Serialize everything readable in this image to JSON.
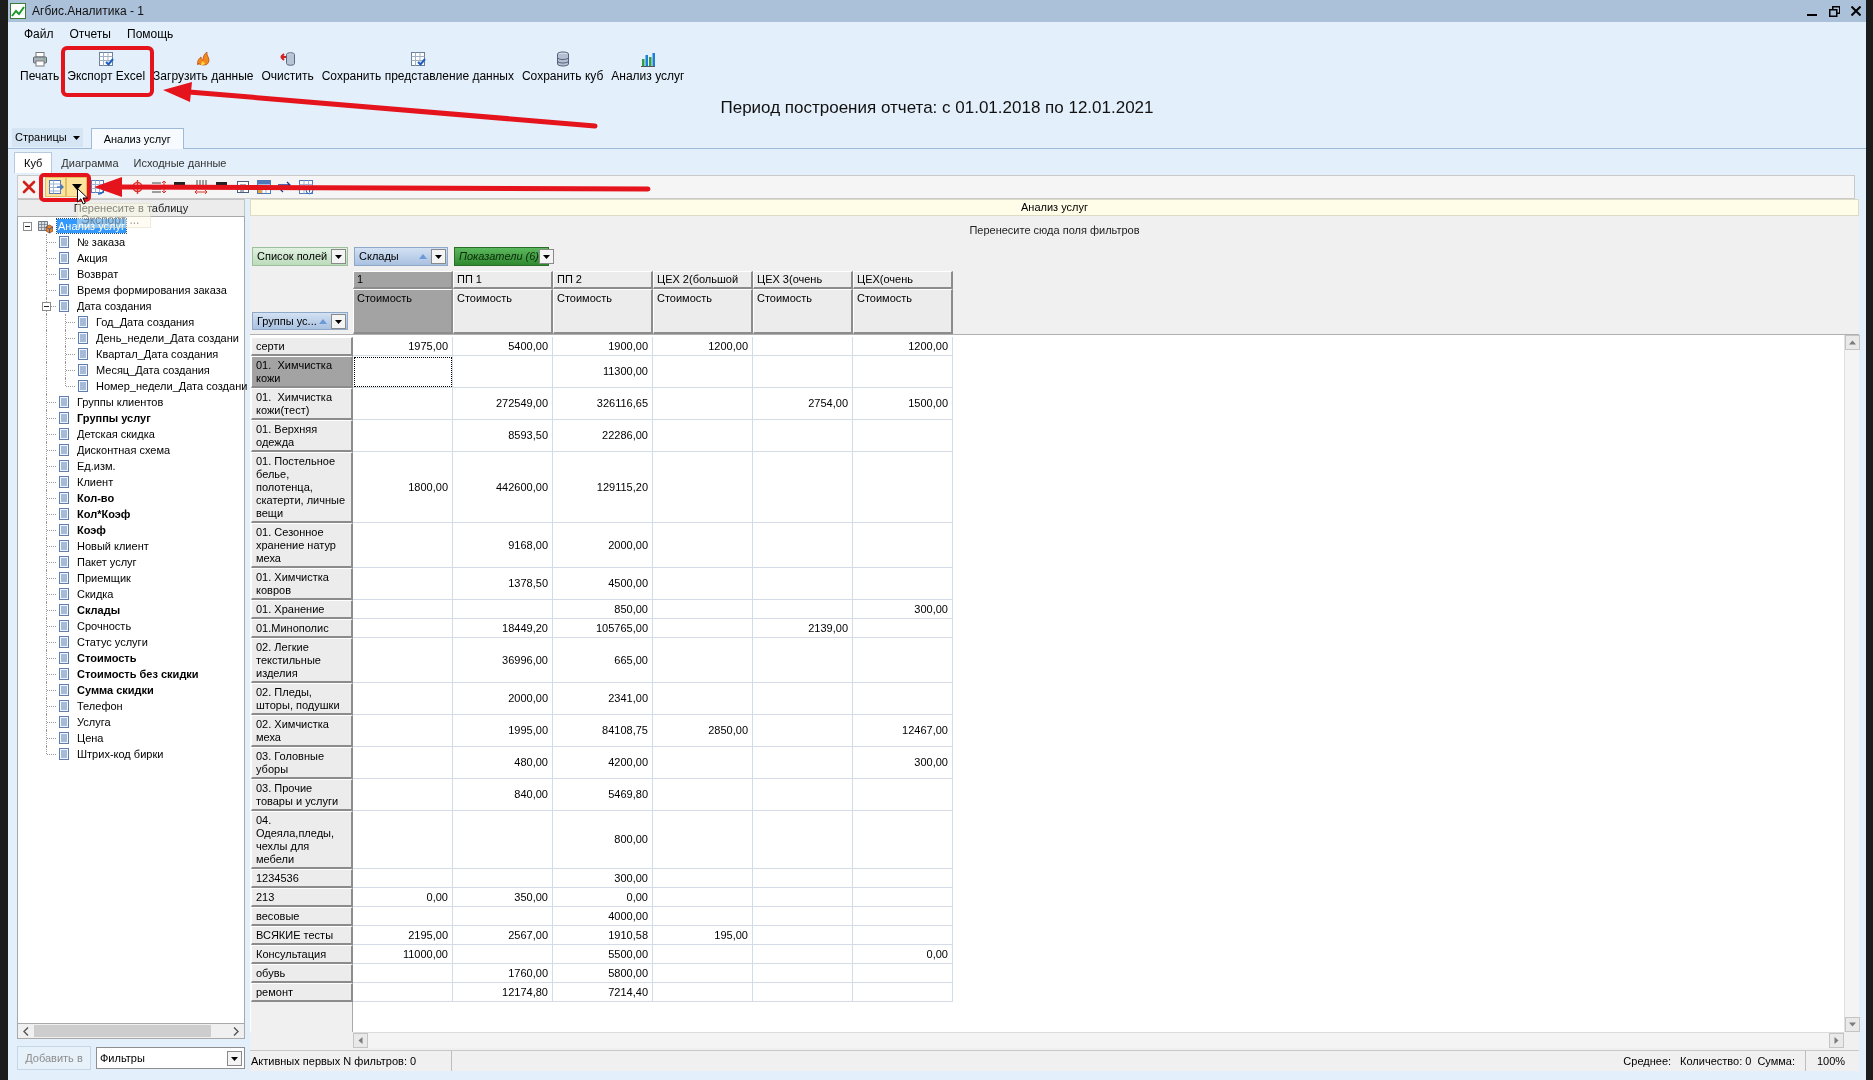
{
  "window": {
    "title": "Агбис.Аналитика - 1"
  },
  "menu": [
    {
      "label": "Файл"
    },
    {
      "label": "Отчеты"
    },
    {
      "label": "Помощь"
    }
  ],
  "toolbar": [
    {
      "kind": "print",
      "label": "Печать"
    },
    {
      "kind": "export",
      "label": "Экспорт Excel"
    },
    {
      "kind": "load",
      "label": "Загрузить данные"
    },
    {
      "kind": "clear",
      "label": "Очистить"
    },
    {
      "kind": "save_view",
      "label": "Сохранить представление данных"
    },
    {
      "kind": "save_cube",
      "label": "Сохранить куб"
    },
    {
      "kind": "analysis",
      "label": "Анализ услуг"
    }
  ],
  "report_period": "Период построения отчета: с 01.01.2018 по 12.01.2021",
  "page_tabs": {
    "menu_label": "Страницы",
    "tabs": [
      {
        "label": "Анализ услуг",
        "selected": true
      }
    ]
  },
  "view_tabs": [
    {
      "label": "Куб",
      "selected": true
    },
    {
      "label": "Диаграмма",
      "selected": false
    },
    {
      "label": "Исходные данные",
      "selected": false
    }
  ],
  "cube_toolbar": [
    {
      "kind": "delete",
      "hovered": false
    },
    {
      "kind": "export",
      "hovered": true
    },
    {
      "kind": "export_menu",
      "hovered": true
    },
    {
      "kind": "table_arrow",
      "hovered": false
    },
    {
      "kind": "split",
      "hovered": false
    },
    {
      "kind": "rows",
      "hovered": false
    },
    {
      "kind": "dash",
      "hovered": false
    },
    {
      "kind": "columns",
      "hovered": false
    },
    {
      "kind": "dash",
      "hovered": false
    },
    {
      "kind": "form",
      "hovered": false
    },
    {
      "kind": "grid",
      "hovered": false
    },
    {
      "kind": "swap",
      "hovered": false
    },
    {
      "kind": "grid_info",
      "hovered": false
    }
  ],
  "tooltip": {
    "text": "Экспорт ..."
  },
  "field_panel": {
    "title": "Перенесите в таблицу",
    "tree": [
      {
        "label": "Анализ услуг",
        "selected": true,
        "active": false,
        "expanded": true,
        "children": [
          {
            "label": "№ заказа",
            "selected": false,
            "active": false
          },
          {
            "label": "Акция",
            "selected": false,
            "active": false
          },
          {
            "label": "Возврат",
            "selected": false,
            "active": false
          },
          {
            "label": "Время формирования заказа",
            "selected": false,
            "active": false
          },
          {
            "label": "Дата создания",
            "selected": false,
            "active": false,
            "expanded": true,
            "children": [
              {
                "label": "Год_Дата создания",
                "selected": false,
                "active": false
              },
              {
                "label": "День_недели_Дата создани",
                "selected": false,
                "active": false
              },
              {
                "label": "Квартал_Дата создания",
                "selected": false,
                "active": false
              },
              {
                "label": "Месяц_Дата создания",
                "selected": false,
                "active": false
              },
              {
                "label": "Номер_недели_Дата создани",
                "selected": false,
                "active": false
              }
            ]
          },
          {
            "label": "Группы клиентов",
            "selected": false,
            "active": false
          },
          {
            "label": "Группы услуг",
            "selected": false,
            "active": true
          },
          {
            "label": "Детская скидка",
            "selected": false,
            "active": false
          },
          {
            "label": "Дисконтная схема",
            "selected": false,
            "active": false
          },
          {
            "label": "Ед.изм.",
            "selected": false,
            "active": false
          },
          {
            "label": "Клиент",
            "selected": false,
            "active": false
          },
          {
            "label": "Кол-во",
            "selected": false,
            "active": true
          },
          {
            "label": "Кол*Коэф",
            "selected": false,
            "active": true
          },
          {
            "label": "Коэф",
            "selected": false,
            "active": true
          },
          {
            "label": "Новый клиент",
            "selected": false,
            "active": false
          },
          {
            "label": "Пакет услуг",
            "selected": false,
            "active": false
          },
          {
            "label": "Приемщик",
            "selected": false,
            "active": false
          },
          {
            "label": "Скидка",
            "selected": false,
            "active": false
          },
          {
            "label": "Склады",
            "selected": false,
            "active": true
          },
          {
            "label": "Срочность",
            "selected": false,
            "active": false
          },
          {
            "label": "Статус услуги",
            "selected": false,
            "active": false
          },
          {
            "label": "Стоимость",
            "selected": false,
            "active": true
          },
          {
            "label": "Стоимость без скидки",
            "selected": false,
            "active": true
          },
          {
            "label": "Сумма скидки",
            "selected": false,
            "active": true
          },
          {
            "label": "Телефон",
            "selected": false,
            "active": false
          },
          {
            "label": "Услуга",
            "selected": false,
            "active": false
          },
          {
            "label": "Цена",
            "selected": false,
            "active": false
          },
          {
            "label": "Штрих-код бирки",
            "selected": false,
            "active": false
          }
        ]
      }
    ],
    "add_button": {
      "label": "Добавить в",
      "disabled": true
    },
    "target": {
      "value": "Фильтры"
    }
  },
  "pivot": {
    "title": "Анализ услуг",
    "filter_hint": "Перенесите сюда поля фильтров",
    "field_list_button": "Список полей",
    "column_fields": [
      {
        "label": "Склады",
        "sort_ascending": true
      }
    ],
    "data_fields_button": "Показатели (6)",
    "row_fields": [
      {
        "label": "Группы ус...",
        "sort_ascending": true
      }
    ],
    "columns": [
      {
        "label": "1",
        "measure": "Стоимость",
        "selected": true
      },
      {
        "label": "ПП 1",
        "measure": "Стоимость",
        "selected": false
      },
      {
        "label": "ПП 2",
        "measure": "Стоимость",
        "selected": false
      },
      {
        "label": "ЦЕХ 2(большой",
        "measure": "Стоимость",
        "selected": false
      },
      {
        "label": "ЦЕХ 3(очень",
        "measure": "Стоимость",
        "selected": false
      },
      {
        "label": "ЦЕХ(очень",
        "measure": "Стоимость",
        "selected": false
      }
    ],
    "rows": [
      {
        "label": "серти",
        "selected": false,
        "values": {
          "col_1": "1975,00",
          "col_2": "5400,00",
          "col_3": "1900,00",
          "col_4": "1200,00",
          "col_6": "1200,00"
        }
      },
      {
        "label": "01.  Химчистка кожи",
        "selected": true,
        "values": {
          "col_3": "11300,00"
        }
      },
      {
        "label": "01.  Химчистка кожи(тест)",
        "selected": false,
        "values": {
          "col_2": "272549,00",
          "col_3": "326116,65",
          "col_5": "2754,00",
          "col_6": "1500,00"
        }
      },
      {
        "label": "01. Верхняя одежда",
        "selected": false,
        "values": {
          "col_2": "8593,50",
          "col_3": "22286,00"
        }
      },
      {
        "label": "01. Постельное белье, полотенца, скатерти, личные вещи",
        "selected": false,
        "values": {
          "col_1": "1800,00",
          "col_2": "442600,00",
          "col_3": "129115,20"
        }
      },
      {
        "label": "01. Сезонное хранение натур меха",
        "selected": false,
        "values": {
          "col_2": "9168,00",
          "col_3": "2000,00"
        }
      },
      {
        "label": "01. Химчистка ковров",
        "selected": false,
        "values": {
          "col_2": "1378,50",
          "col_3": "4500,00"
        }
      },
      {
        "label": "01. Хранение",
        "selected": false,
        "values": {
          "col_3": "850,00",
          "col_6": "300,00"
        }
      },
      {
        "label": "01.Минополис",
        "selected": false,
        "values": {
          "col_2": "18449,20",
          "col_3": "105765,00",
          "col_5": "2139,00"
        }
      },
      {
        "label": "02. Легкие текстильные изделия",
        "selected": false,
        "values": {
          "col_2": "36996,00",
          "col_3": "665,00"
        }
      },
      {
        "label": "02. Пледы, шторы, подушки",
        "selected": false,
        "values": {
          "col_2": "2000,00",
          "col_3": "2341,00"
        }
      },
      {
        "label": "02. Химчистка меха",
        "selected": false,
        "values": {
          "col_2": "1995,00",
          "col_3": "84108,75",
          "col_4": "2850,00",
          "col_6": "12467,00"
        }
      },
      {
        "label": "03. Головные уборы",
        "selected": false,
        "values": {
          "col_2": "480,00",
          "col_3": "4200,00",
          "col_6": "300,00"
        }
      },
      {
        "label": "03. Прочие товары и услуги",
        "selected": false,
        "values": {
          "col_2": "840,00",
          "col_3": "5469,80"
        }
      },
      {
        "label": "04. Одеяла,пледы, чехлы для мебели",
        "selected": false,
        "values": {
          "col_3": "800,00"
        }
      },
      {
        "label": "1234536",
        "selected": false,
        "values": {
          "col_3": "300,00"
        }
      },
      {
        "label": "213",
        "selected": false,
        "values": {
          "col_1": "0,00",
          "col_2": "350,00",
          "col_3": "0,00"
        }
      },
      {
        "label": "весовые",
        "selected": false,
        "values": {
          "col_3": "4000,00"
        }
      },
      {
        "label": "ВСЯКИЕ тесты",
        "selected": false,
        "values": {
          "col_1": "2195,00",
          "col_2": "2567,00",
          "col_3": "1910,58",
          "col_4": "195,00"
        }
      },
      {
        "label": "Консультация",
        "selected": false,
        "values": {
          "col_1": "11000,00",
          "col_3": "5500,00",
          "col_6": "0,00"
        }
      },
      {
        "label": "обувь",
        "selected": false,
        "values": {
          "col_2": "1760,00",
          "col_3": "5800,00"
        }
      },
      {
        "label": "ремонт",
        "selected": false,
        "values": {
          "col_2": "12174,80",
          "col_3": "7214,40"
        }
      }
    ]
  },
  "status_bar": {
    "filter_info": "Активных первых N фильтров: 0",
    "average": "Среднее:",
    "count": "Количество: 0",
    "sum": "Сумма:",
    "zoom": "100%"
  }
}
